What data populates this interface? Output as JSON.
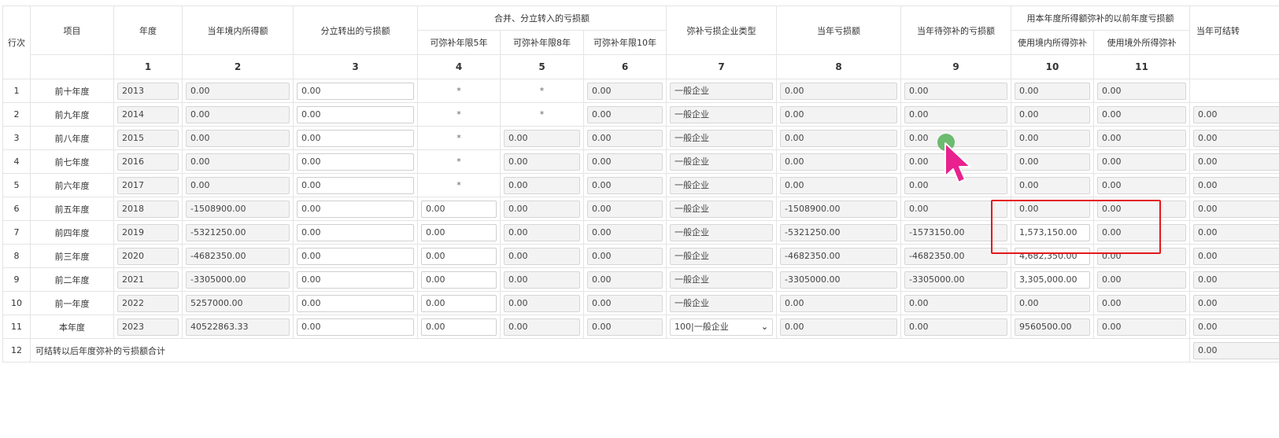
{
  "headers": {
    "row_no": "行次",
    "item": "项目",
    "year": "年度",
    "income": "当年境内所得额",
    "split_out": "分立转出的亏损额",
    "merge_group": "合并、分立转入的亏损额",
    "m5": "可弥补年限5年",
    "m8": "可弥补年限8年",
    "m10": "可弥补年限10年",
    "type": "弥补亏损企业类型",
    "loss": "当年亏损额",
    "pending": "当年待弥补的亏损额",
    "use_group": "用本年度所得额弥补的以前年度亏损额",
    "use_domestic": "使用境内所得弥补",
    "use_foreign": "使用境外所得弥补",
    "carry_partial": "当年可结转"
  },
  "col_numbers": [
    "1",
    "2",
    "3",
    "4",
    "5",
    "6",
    "7",
    "8",
    "9",
    "10",
    "11"
  ],
  "rows": [
    {
      "no": "1",
      "item": "前十年度",
      "year": "2013",
      "income": "0.00",
      "split": "0.00",
      "m5": "*",
      "m8": "*",
      "m10": "0.00",
      "type": "一般企业",
      "loss": "0.00",
      "pending": "0.00",
      "dom": "0.00",
      "for": "0.00",
      "carry": ""
    },
    {
      "no": "2",
      "item": "前九年度",
      "year": "2014",
      "income": "0.00",
      "split": "0.00",
      "m5": "*",
      "m8": "*",
      "m10": "0.00",
      "type": "一般企业",
      "loss": "0.00",
      "pending": "0.00",
      "dom": "0.00",
      "for": "0.00",
      "carry": "0.00"
    },
    {
      "no": "3",
      "item": "前八年度",
      "year": "2015",
      "income": "0.00",
      "split": "0.00",
      "m5": "*",
      "m8": "0.00",
      "m10": "0.00",
      "type": "一般企业",
      "loss": "0.00",
      "pending": "0.00",
      "dom": "0.00",
      "for": "0.00",
      "carry": "0.00"
    },
    {
      "no": "4",
      "item": "前七年度",
      "year": "2016",
      "income": "0.00",
      "split": "0.00",
      "m5": "*",
      "m8": "0.00",
      "m10": "0.00",
      "type": "一般企业",
      "loss": "0.00",
      "pending": "0.00",
      "dom": "0.00",
      "for": "0.00",
      "carry": "0.00"
    },
    {
      "no": "5",
      "item": "前六年度",
      "year": "2017",
      "income": "0.00",
      "split": "0.00",
      "m5": "*",
      "m8": "0.00",
      "m10": "0.00",
      "type": "一般企业",
      "loss": "0.00",
      "pending": "0.00",
      "dom": "0.00",
      "for": "0.00",
      "carry": "0.00"
    },
    {
      "no": "6",
      "item": "前五年度",
      "year": "2018",
      "income": "-1508900.00",
      "split": "0.00",
      "m5": "0.00",
      "m8": "0.00",
      "m10": "0.00",
      "type": "一般企业",
      "loss": "-1508900.00",
      "pending": "0.00",
      "dom": "0.00",
      "for": "0.00",
      "carry": "0.00"
    },
    {
      "no": "7",
      "item": "前四年度",
      "year": "2019",
      "income": "-5321250.00",
      "split": "0.00",
      "m5": "0.00",
      "m8": "0.00",
      "m10": "0.00",
      "type": "一般企业",
      "loss": "-5321250.00",
      "pending": "-1573150.00",
      "dom": "1,573,150.00",
      "for": "0.00",
      "carry": "0.00"
    },
    {
      "no": "8",
      "item": "前三年度",
      "year": "2020",
      "income": "-4682350.00",
      "split": "0.00",
      "m5": "0.00",
      "m8": "0.00",
      "m10": "0.00",
      "type": "一般企业",
      "loss": "-4682350.00",
      "pending": "-4682350.00",
      "dom": "4,682,350.00",
      "for": "0.00",
      "carry": "0.00"
    },
    {
      "no": "9",
      "item": "前二年度",
      "year": "2021",
      "income": "-3305000.00",
      "split": "0.00",
      "m5": "0.00",
      "m8": "0.00",
      "m10": "0.00",
      "type": "一般企业",
      "loss": "-3305000.00",
      "pending": "-3305000.00",
      "dom": "3,305,000.00",
      "for": "0.00",
      "carry": "0.00"
    },
    {
      "no": "10",
      "item": "前一年度",
      "year": "2022",
      "income": "5257000.00",
      "split": "0.00",
      "m5": "0.00",
      "m8": "0.00",
      "m10": "0.00",
      "type": "一般企业",
      "loss": "0.00",
      "pending": "0.00",
      "dom": "0.00",
      "for": "0.00",
      "carry": "0.00"
    },
    {
      "no": "11",
      "item": "本年度",
      "year": "2023",
      "income": "40522863.33",
      "split": "0.00",
      "m5": "0.00",
      "m8": "0.00",
      "m10": "0.00",
      "type": "100|一般企业",
      "loss": "0.00",
      "pending": "0.00",
      "dom": "9560500.00",
      "for": "0.00",
      "carry": "0.00"
    }
  ],
  "footer": {
    "no": "12",
    "label": "可结转以后年度弥补的亏损额合计",
    "total": "0.00"
  },
  "select_arrow": "⌄"
}
